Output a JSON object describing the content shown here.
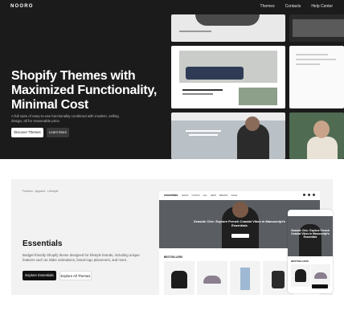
{
  "nav": {
    "logo": "NOORO",
    "links": [
      "Themes",
      "Contacts",
      "Help Center"
    ]
  },
  "hero": {
    "title": "Shopify Themes with Maximized Functionality, Minimal Cost",
    "subtitle": "A full suite of easy-to-use functionality combined with modern, selling design, all for reasonable price.",
    "primary_button": "Discover Themes",
    "secondary_button": "Learn More"
  },
  "essentials": {
    "tag": "Fashion - Apparel - Lifestyle",
    "title": "Essentials",
    "description": "Budget-friendly Shopify theme designed for lifestyle brands, including unique features such as slider animations, brand logo placement, and more.",
    "primary_button": "Explore Essentials",
    "secondary_button": "Explore All Themes",
    "desktop_preview": {
      "logo": "essentials",
      "nav_items": [
        "SHOP",
        "COATS",
        "ALL",
        "NEW",
        "BRAND",
        "SALE"
      ],
      "hero_caption": "Seaside Chic: Explore French Coastal Vibes in Manuscript's Essentials",
      "section_title": "BESTSELLERS"
    },
    "mobile_preview": {
      "hero_caption": "Seaside Chic: Explore French Coastal Vibes in Manuscript's Essentials",
      "section_title": "BESTSELLERS"
    }
  }
}
